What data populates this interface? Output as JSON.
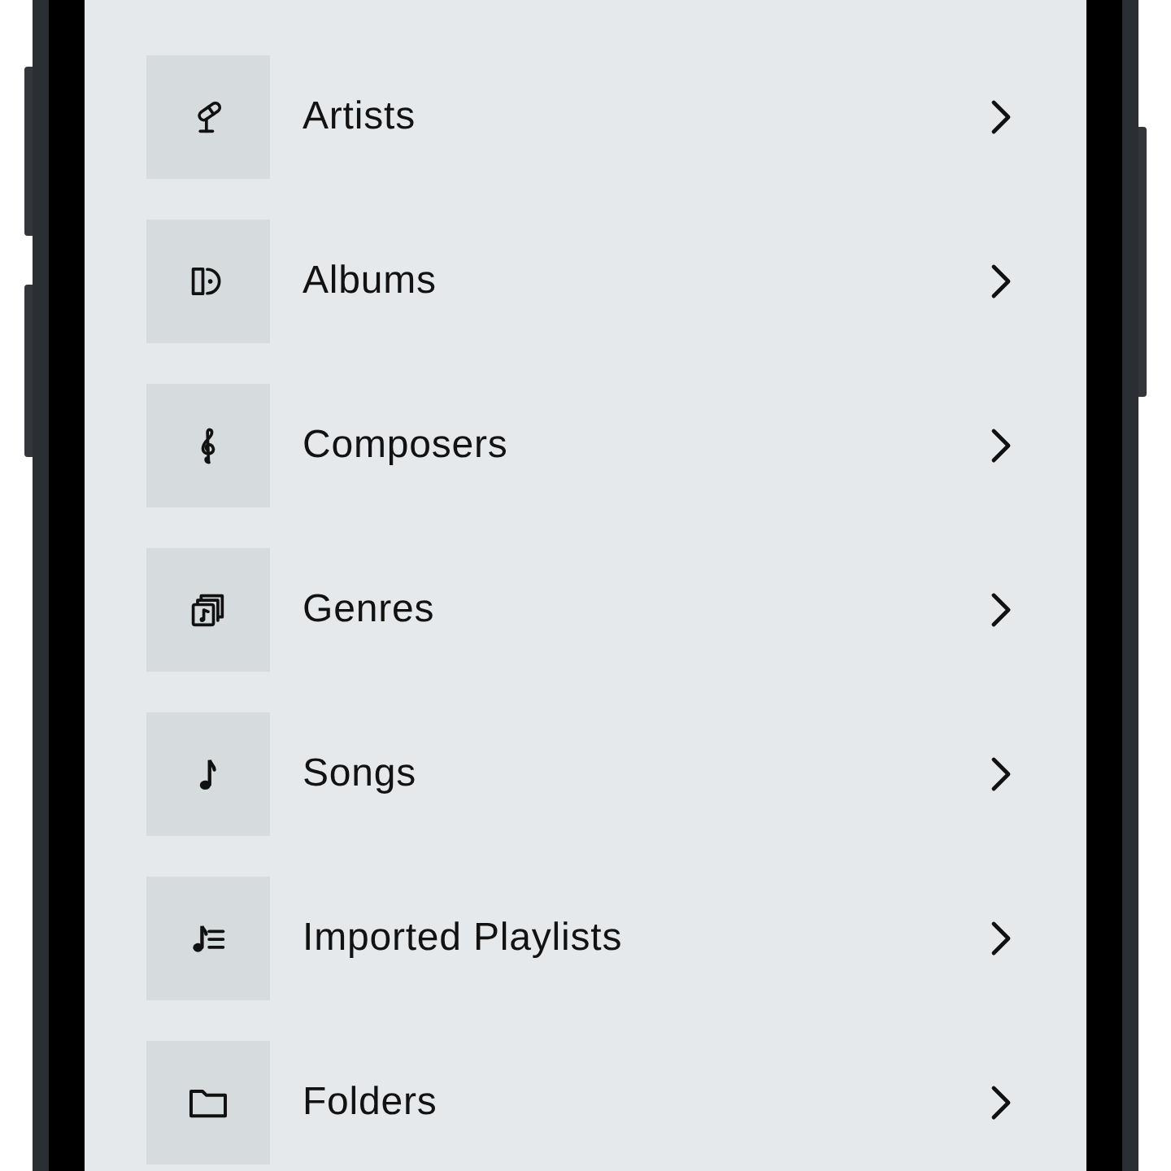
{
  "items": [
    {
      "label": "Artists",
      "kind": "microphone"
    },
    {
      "label": "Albums",
      "kind": "album"
    },
    {
      "label": "Composers",
      "kind": "clef"
    },
    {
      "label": "Genres",
      "kind": "stack"
    },
    {
      "label": "Songs",
      "kind": "note"
    },
    {
      "label": "Imported Playlists",
      "kind": "playlist"
    },
    {
      "label": "Folders",
      "kind": "folder"
    }
  ]
}
